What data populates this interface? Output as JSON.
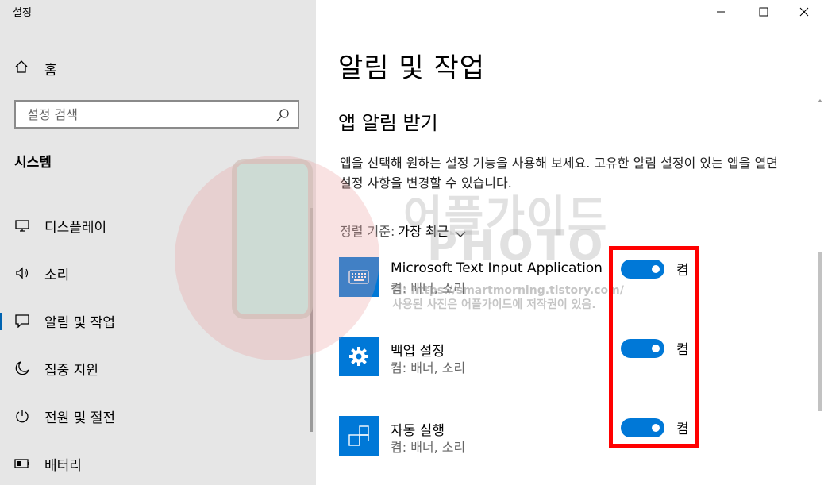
{
  "window": {
    "title": "설정",
    "minimize_icon": "minimize-icon",
    "maximize_icon": "maximize-icon",
    "close_icon": "close-icon"
  },
  "sidebar": {
    "home_label": "홈",
    "search_placeholder": "설정 검색",
    "section_title": "시스템",
    "items": [
      {
        "label": "디스플레이",
        "icon": "display-icon",
        "active": false
      },
      {
        "label": "소리",
        "icon": "speaker-icon",
        "active": false
      },
      {
        "label": "알림 및 작업",
        "icon": "notification-icon",
        "active": true
      },
      {
        "label": "집중 지원",
        "icon": "moon-icon",
        "active": false
      },
      {
        "label": "전원 및 절전",
        "icon": "power-icon",
        "active": false
      },
      {
        "label": "배터리",
        "icon": "battery-icon",
        "active": false
      }
    ]
  },
  "main": {
    "title": "알림 및 작업",
    "subtitle": "앱 알림 받기",
    "description": "앱을 선택해 원하는 설정 기능을 사용해 보세요. 고유한 알림 설정이 있는 앱을 열면 설정 사항을 변경할 수 있습니다.",
    "sort_label": "정렬 기준:",
    "sort_value": "가장 최근",
    "apps": [
      {
        "name": "Microsoft Text Input Application",
        "sub": "켬: 배너, 소리",
        "state": "켬",
        "on": true,
        "icon": "keyboard-icon"
      },
      {
        "name": "백업 설정",
        "sub": "켬: 배너, 소리",
        "state": "켬",
        "on": true,
        "icon": "gear-icon"
      },
      {
        "name": "자동 실행",
        "sub": "켬: 배너, 소리",
        "state": "켬",
        "on": true,
        "icon": "autoplay-icon"
      }
    ]
  },
  "watermark": {
    "brand_line1": "어플가이드",
    "brand_line2": "PHOTO",
    "url": "켬: https://smartmorning.tistory.com/",
    "note": "사용된 사진은 어플가이드에 저작권이 있음."
  },
  "colors": {
    "accent": "#0078d7",
    "highlight": "#ff0000",
    "sidebar_bg": "#e6e6e6"
  }
}
